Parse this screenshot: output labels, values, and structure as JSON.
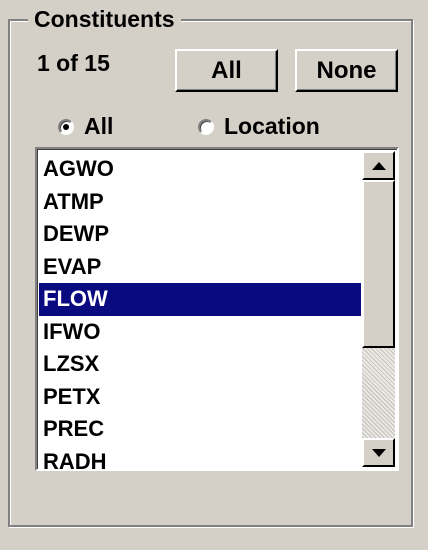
{
  "constituents": {
    "legend": "Constituents",
    "count_text": "1 of 15",
    "all_button": "All",
    "none_button": "None",
    "radio_options": [
      {
        "label": "All",
        "checked": true
      },
      {
        "label": "Location",
        "checked": false
      }
    ],
    "list_items": [
      "AGWO",
      "ATMP",
      "DEWP",
      "EVAP",
      "FLOW",
      "IFWO",
      "LZSX",
      "PETX",
      "PREC",
      "RADH"
    ],
    "selected_item": "FLOW"
  },
  "colors": {
    "background": "#d4d0c8",
    "selection": "#0a0a80"
  },
  "icons": {
    "scroll_up": "scroll-up-arrow-icon",
    "scroll_down": "scroll-down-arrow-icon"
  }
}
